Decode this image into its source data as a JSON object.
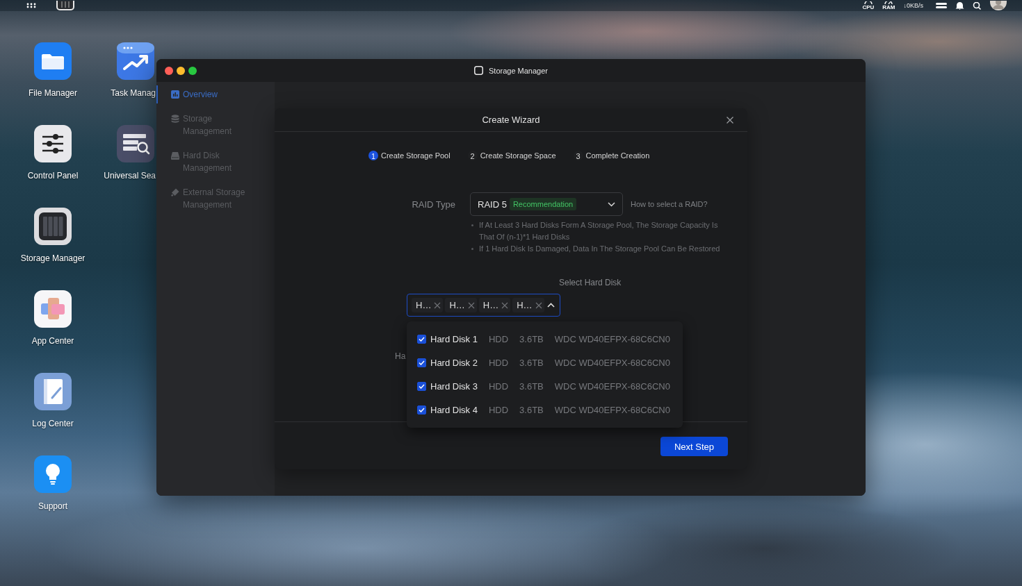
{
  "top_bar": {
    "indicators": [
      {
        "kind": "cpu",
        "label": "CPU"
      },
      {
        "kind": "ram",
        "label": "RAM"
      }
    ],
    "network_speed": "↓0KB/s"
  },
  "desktop_columns": [
    [
      {
        "kind": "files",
        "label": "File Manager"
      },
      {
        "kind": "control",
        "label": "Control Panel"
      },
      {
        "kind": "storage",
        "label": "Storage Manager"
      },
      {
        "kind": "apps",
        "label": "App Center"
      },
      {
        "kind": "logs",
        "label": "Log Center"
      },
      {
        "kind": "support",
        "label": "Support"
      }
    ],
    [
      {
        "kind": "tasks",
        "label": "Task Manag"
      },
      {
        "kind": "search",
        "label": "Universal Sea"
      }
    ]
  ],
  "window": {
    "title": "Storage Manager",
    "sidebar": {
      "items": [
        {
          "kind": "overview",
          "label": "Overview",
          "selected": true
        },
        {
          "kind": "storage",
          "label": "Storage Management",
          "selected": false
        },
        {
          "kind": "disk",
          "label": "Hard Disk Management",
          "selected": false
        },
        {
          "kind": "external",
          "label": "External Storage Management",
          "selected": false
        }
      ]
    },
    "dialog": {
      "title": "Create Wizard",
      "steps": [
        {
          "number": "1",
          "label": "Create Storage Pool",
          "selected": true
        },
        {
          "number": "2",
          "label": "Create Storage Space",
          "selected": false
        },
        {
          "number": "3",
          "label": "Complete Creation",
          "selected": false
        }
      ],
      "raid_type": {
        "label": "RAID Type",
        "value": "RAID 5",
        "badge": "Recommendation",
        "help_link": "How to select a RAID?",
        "notes": [
          "If At Least 3 Hard Disks Form A Storage Pool, The Storage Capacity Is That Of (n-1)*1 Hard Disks",
          "If 1 Hard Disk Is Damaged, Data In The Storage Pool Can Be Restored"
        ]
      },
      "disk_select": {
        "label": "Select Hard Disk",
        "expanded": true,
        "tags": [
          "H…",
          "H…",
          "H…",
          "H…"
        ],
        "options": [
          {
            "name": "Hard Disk 1",
            "type": "HDD",
            "capacity": "3.6TB",
            "model": "WDC WD40EFPX-68C6CN0",
            "checked": true
          },
          {
            "name": "Hard Disk 2",
            "type": "HDD",
            "capacity": "3.6TB",
            "model": "WDC WD40EFPX-68C6CN0",
            "checked": true
          },
          {
            "name": "Hard Disk 3",
            "type": "HDD",
            "capacity": "3.6TB",
            "model": "WDC WD40EFPX-68C6CN0",
            "checked": true
          },
          {
            "name": "Hard Disk 4",
            "type": "HDD",
            "capacity": "3.6TB",
            "model": "WDC WD40EFPX-68C6CN0",
            "checked": true
          }
        ]
      },
      "covered_label": "Ha",
      "buttons": [
        {
          "kind": "primary",
          "label": "Next Step"
        }
      ]
    }
  }
}
